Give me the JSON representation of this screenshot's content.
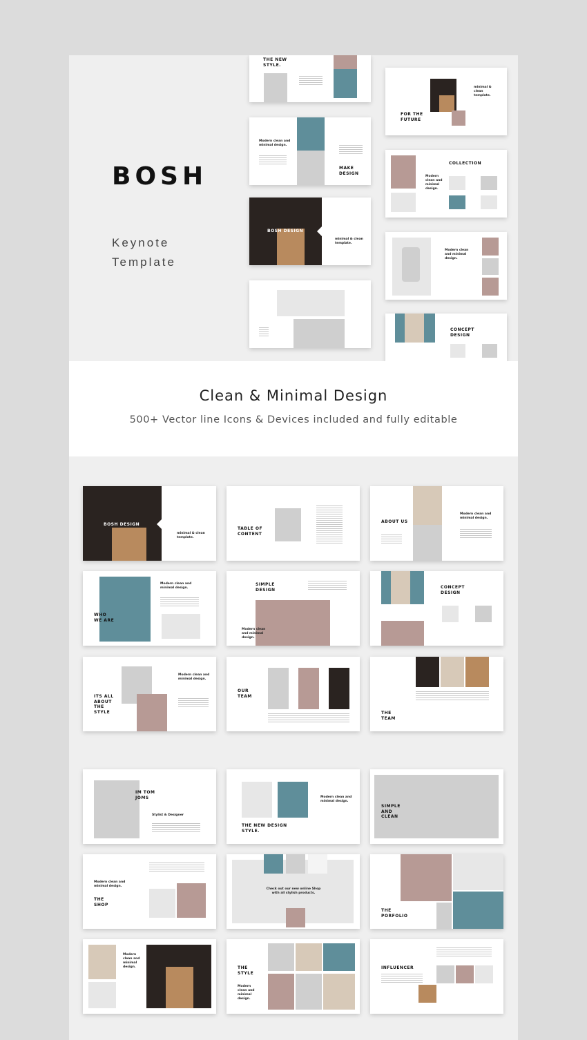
{
  "hero": {
    "brand": "BOSH",
    "subtitle_line1": "Keynote",
    "subtitle_line2": "Template"
  },
  "band": {
    "title": "Clean & Minimal Design",
    "subtitle": "500+ Vector line Icons & Devices included and fully editable"
  },
  "slides": {
    "new_style": "THE NEW STYLE.",
    "future": "FOR THE FUTURE",
    "make_design": "MAKE DESIGN",
    "collection": "COLLECTION",
    "bosh_design": "BOSH DESIGN",
    "minimal_clean": "minimal & clean template.",
    "concept_design": "CONCEPT DESIGN",
    "table_of_content": "TABLE OF CONTENT",
    "about_us": "ABOUT US",
    "modern_clean": "Modern clean and minimal design.",
    "who_we_are": "WHO WE ARE",
    "simple_design": "SIMPLE DESIGN",
    "its_all_style": "ITS ALL ABOUT THE STYLE",
    "our_team": "OUR TEAM",
    "the_team": "THE TEAM",
    "im_tom_joms": "IM TOM JOMS",
    "stylist": "Stylist & Designer",
    "new_design_style": "THE NEW DESIGN STYLE.",
    "simple_clean": "SIMPLE AND CLEAN",
    "the_shop": "THE SHOP",
    "check_shop": "Check out our new online Shop with all stylish products.",
    "portfolio": "THE PORFOLIO",
    "the_style": "THE STYLE",
    "influencer": "INFLUENCER"
  }
}
